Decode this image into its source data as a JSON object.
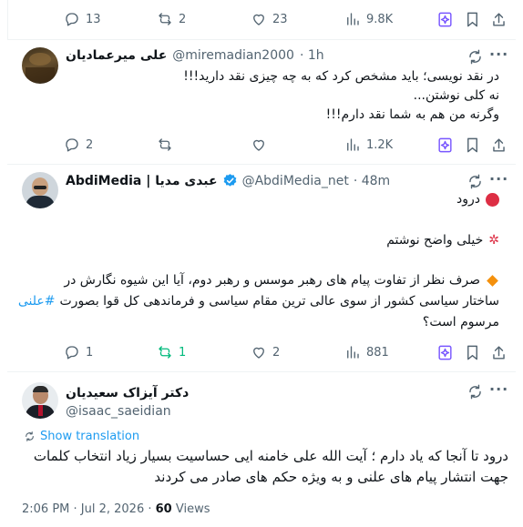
{
  "top_tweet": {
    "replies": "13",
    "reposts": "2",
    "likes": "23",
    "views": "9.8K"
  },
  "reply1": {
    "name": "علی میرعمادیان",
    "handle": "@miremadian2000",
    "time": "· 1h",
    "lines": [
      "در نقد نویسی؛ باید مشخص کرد که به چه چیزی نقد دارید!!!",
      "نه کلی نوشتن...",
      "وگرنه من هم به شما نقد دارم!!!"
    ],
    "replies": "2",
    "reposts": "",
    "likes": "",
    "views": "1.2K"
  },
  "reply2": {
    "name": "AbdiMedia | عبدی مدیا",
    "handle": "@AbdiMedia_net",
    "time": "· 48m",
    "greeting": "درود",
    "line2": "خیلی واضح نوشتم",
    "para_line1": "صرف نظر از تفاوت پیام های رهبر موسس و رهبر دوم، آیا  این شیوه نگارش در",
    "para_line2_prefix": "ساختار سیاسی کشور از سوی عالی ترین مقام سیاسی و فرماندهی کل قوا بصورت",
    "hashtag": "#علنی",
    "para_line3": "مرسوم است؟",
    "replies": "1",
    "reposts": "1",
    "likes": "2",
    "views": "881"
  },
  "main_tweet": {
    "name": "دکتر آیزاک سعیدیان",
    "handle": "@isaac_saeidian",
    "show_translation": "Show translation",
    "line1": "درود تا آنجا که یاد دارم ؛ آیت الله علی خامنه ایی حساسیت بسیار زیاد انتخاب کلمات",
    "line2": "جهت انتشار پیام های علنی و به ویژه حکم های صادر می کردند",
    "timestamp": "2:06 PM · Jul 2, 2026 · ",
    "views_count": "60",
    "views_label": " Views"
  },
  "colors": {
    "accent": "#1d9bf0",
    "repost_active": "#00ba7c",
    "grok": "#7856ff",
    "muted": "#536471",
    "verified": "#1d9bf0"
  },
  "icons": [
    "reply-icon",
    "repost-icon",
    "like-icon",
    "views-icon",
    "grok-icon",
    "bookmark-icon",
    "share-icon",
    "more-icon",
    "verified-icon",
    "translate-icon"
  ]
}
